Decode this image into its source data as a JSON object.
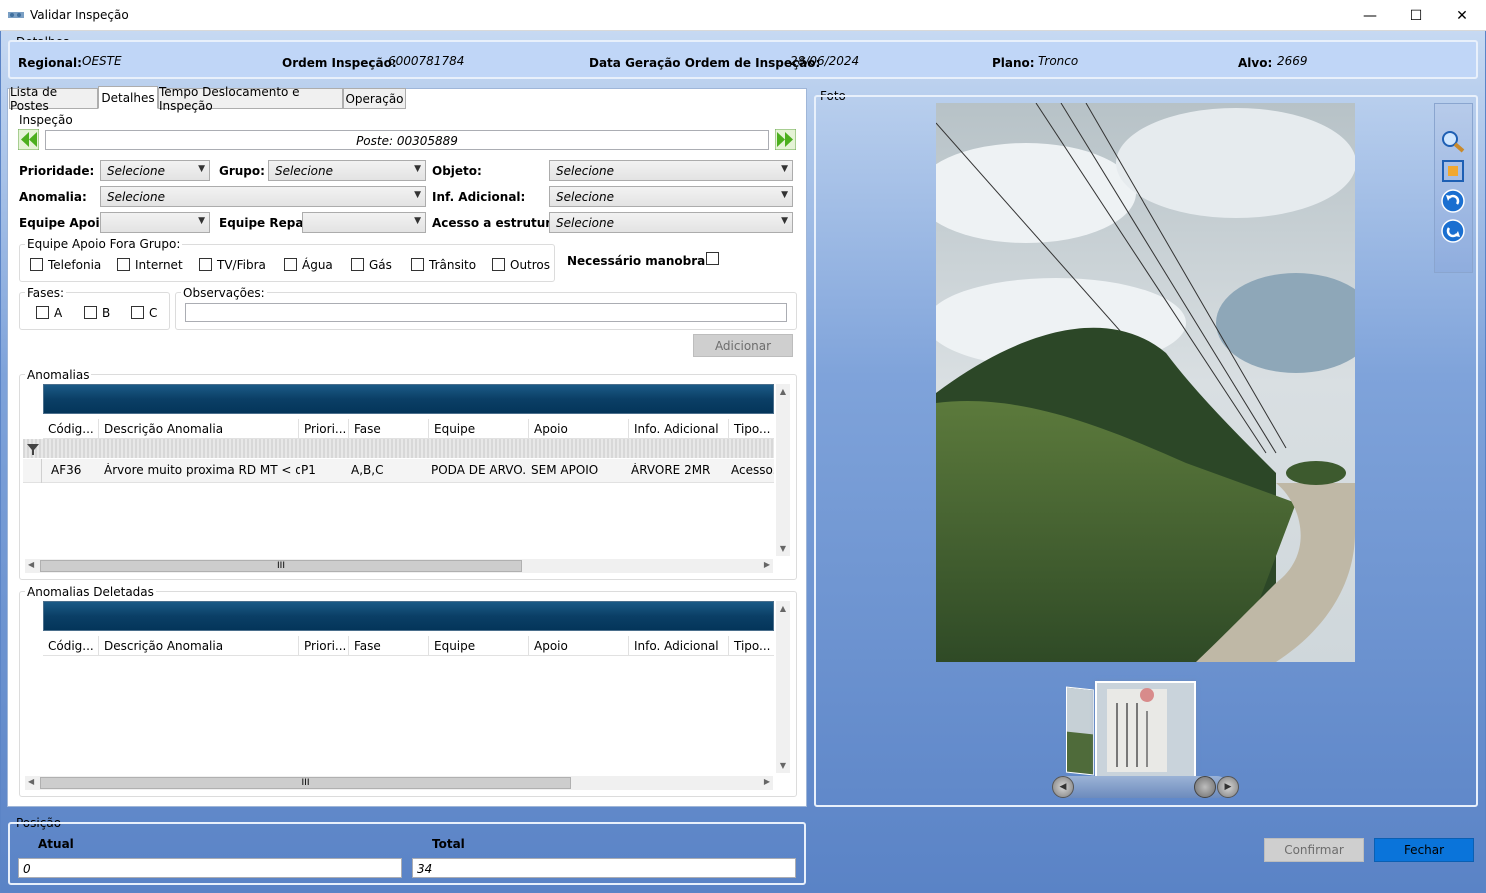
{
  "window": {
    "title": "Validar Inspeção",
    "minimize": "—",
    "maximize": "☐",
    "close": "✕"
  },
  "detalhes": {
    "legend": "Detalhes",
    "regional_label": "Regional:",
    "regional_value": "OESTE",
    "ordem_label": "Ordem Inspeção:",
    "ordem_value": "6000781784",
    "data_label": "Data Geração Ordem de Inspeção:",
    "data_value": "28/06/2024",
    "plano_label": "Plano:",
    "plano_value": "Tronco",
    "alvo_label": "Alvo:",
    "alvo_value": "2669"
  },
  "tabs": [
    {
      "label": "Lista de Postes"
    },
    {
      "label": "Detalhes"
    },
    {
      "label": "Tempo Deslocamento e Inspeção"
    },
    {
      "label": "Operação"
    }
  ],
  "inspecao": {
    "legend": "Inspeção",
    "poste": "Poste: 00305889",
    "prioridade_label": "Prioridade:",
    "prioridade_value": "Selecione",
    "grupo_label": "Grupo:",
    "grupo_value": "Selecione",
    "objeto_label": "Objeto:",
    "objeto_value": "Selecione",
    "anomalia_label": "Anomalia:",
    "anomalia_value": "Selecione",
    "infadicional_label": "Inf. Adicional:",
    "infadicional_value": "Selecione",
    "equipeapoio_label": "Equipe Apoio:",
    "equipeapoio_value": "",
    "equipereparo_label": "Equipe Reparo:",
    "equipereparo_value": "",
    "acesso_label": "Acesso a estrutura:",
    "acesso_value": "Selecione",
    "fora_grupo_legend": "Equipe Apoio Fora Grupo:",
    "fora_grupo": [
      "Telefonia",
      "Internet",
      "TV/Fibra",
      "Água",
      "Gás",
      "Trânsito",
      "Outros"
    ],
    "manobra_label": "Necessário manobra:",
    "fases_legend": "Fases:",
    "fases": [
      "A",
      "B",
      "C"
    ],
    "obs_legend": "Observações:",
    "obs_value": "",
    "adicionar": "Adicionar"
  },
  "anomalias": {
    "legend": "Anomalias",
    "columns": [
      "Códig...",
      "Descrição Anomalia",
      "Priori...",
      "Fase",
      "Equipe",
      "Apoio",
      "Info. Adicional",
      "Tipo..."
    ],
    "rows": [
      [
        "AF36",
        "Árvore muito proxima RD MT < d...",
        "P1",
        "A,B,C",
        "PODA DE ARVO...",
        "SEM APOIO",
        "ÁRVORE 2MR",
        "Acesso..."
      ]
    ],
    "scroll_grip": "III"
  },
  "anomalias_deletadas": {
    "legend": "Anomalias Deletadas",
    "columns": [
      "Códig...",
      "Descrição Anomalia",
      "Priori...",
      "Fase",
      "Equipe",
      "Apoio",
      "Info. Adicional",
      "Tipo..."
    ],
    "scroll_grip": "III"
  },
  "foto": {
    "legend": "Foto"
  },
  "posicao": {
    "legend": "Posição",
    "atual_label": "Atual",
    "atual_value": "0",
    "total_label": "Total",
    "total_value": "34"
  },
  "buttons": {
    "confirmar": "Confirmar",
    "fechar": "Fechar"
  },
  "colors": {
    "accent": "#0a74da",
    "header": "#0b3f66",
    "panel": "#c0d6f7"
  }
}
